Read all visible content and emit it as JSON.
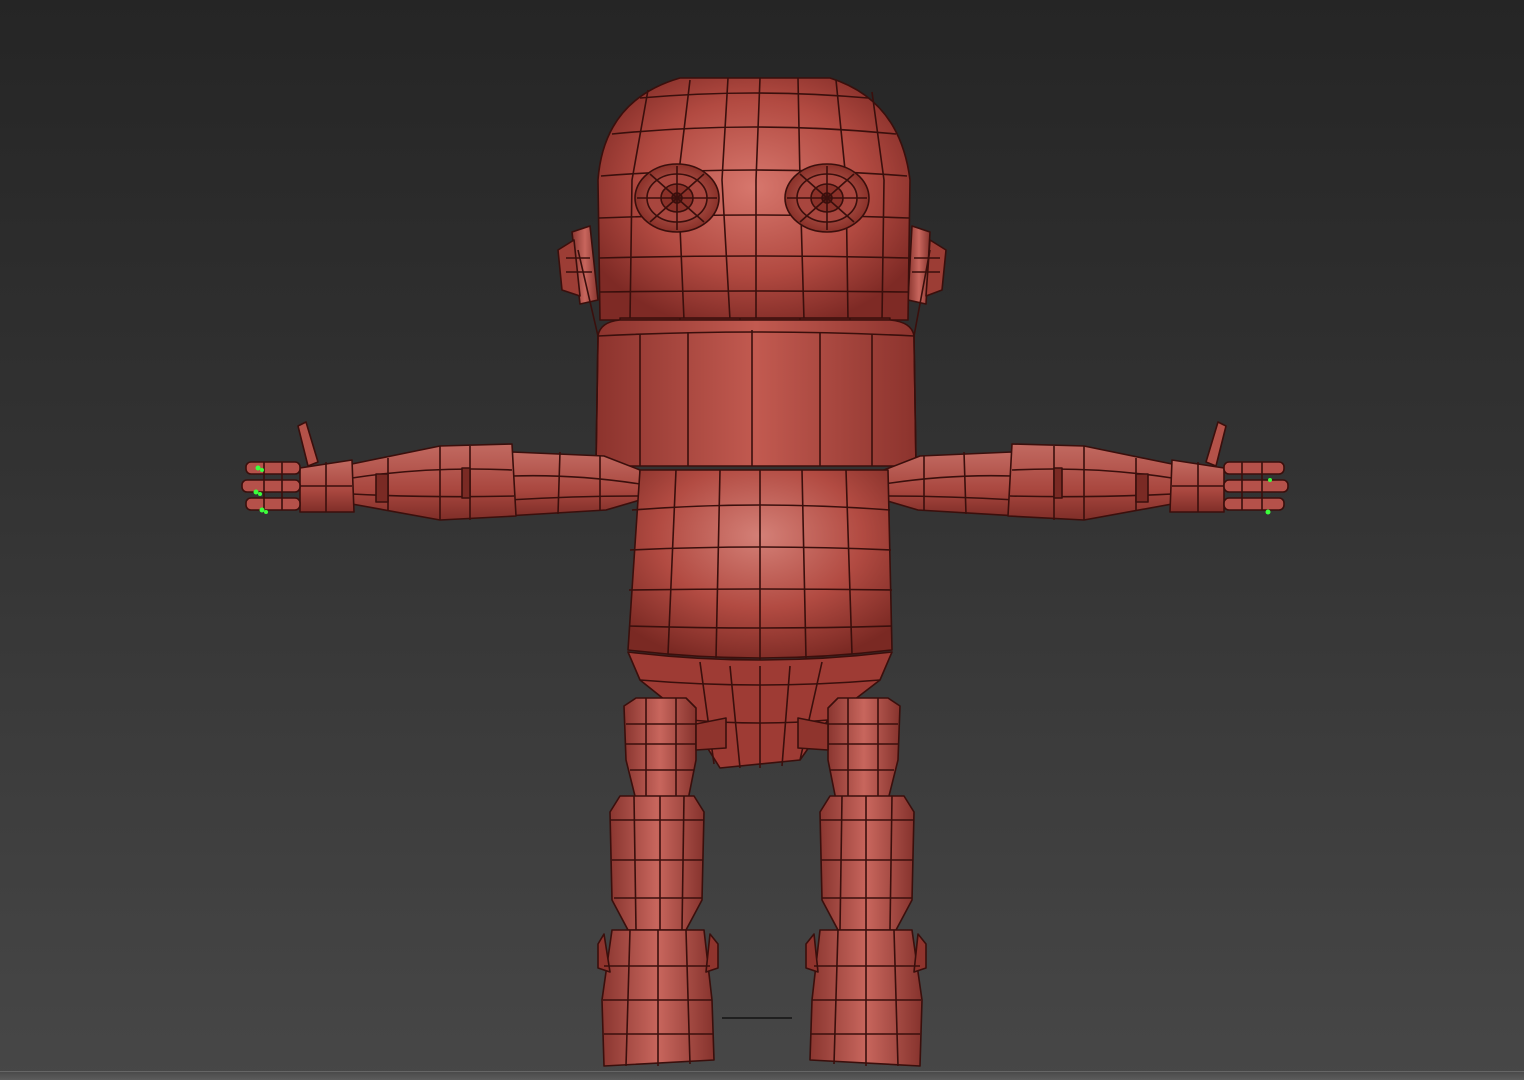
{
  "viewport": {
    "mode": "perspective",
    "shading": "shaded-wireframe",
    "background_top": "#252525",
    "background_bottom": "#474747"
  },
  "model": {
    "name_visible": false,
    "material_color": "#b5473f",
    "wire_color": "#3a0f0c",
    "highlight_color": "#d97a70",
    "selection_vertex_color": "#3cff3c",
    "pose": "T-pose"
  }
}
